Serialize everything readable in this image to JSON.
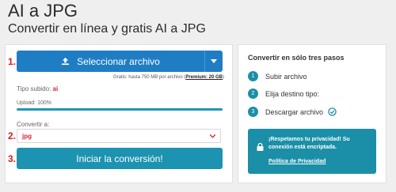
{
  "header": {
    "title": "AI a JPG",
    "subtitle": "Convertir en línea y gratis AI a JPG"
  },
  "steps_markers": [
    "1.",
    "2.",
    "3."
  ],
  "upload": {
    "button_label": "Seleccionar archivo",
    "limit_note": "Gratis: hasta 750 MB por archivo (",
    "limit_premium": "Premium: 20 GB",
    "limit_close": ")",
    "uploaded_type_label": "Tipo subido:",
    "uploaded_type_value": "ai",
    "status": "Upload: 100%",
    "progress_fraction": 1.0
  },
  "convert": {
    "label": "Convertir a:",
    "selected_format": "jpg",
    "start_label": "Iniciar la conversión!"
  },
  "sidebar": {
    "title": "Convertir en sólo tres pasos",
    "steps": [
      {
        "num": "1",
        "label": "Subir archivo"
      },
      {
        "num": "2",
        "label": "Elija destino tipo:"
      },
      {
        "num": "3",
        "label": "Descargar archivo"
      }
    ],
    "privacy": {
      "text": "¡Respetamos tu privacidad! Su conexión está encriptada.",
      "link": "Política de Privacidad"
    }
  },
  "colors": {
    "primary_blue": "#1f7dc4",
    "teal": "#1c8fa8",
    "red": "#d9232d"
  }
}
